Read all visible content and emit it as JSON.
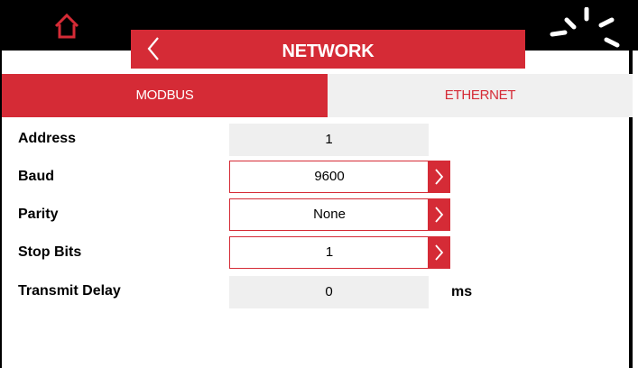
{
  "header": {
    "title": "NETWORK",
    "home_icon": "home-icon",
    "back_icon": "chevron-left-icon",
    "activity_icon": "loading-spinner-icon",
    "accent_color": "#d52b36"
  },
  "tabs": [
    {
      "label": "MODBUS",
      "active": true
    },
    {
      "label": "ETHERNET",
      "active": false
    }
  ],
  "settings": {
    "address": {
      "label": "Address",
      "value": "1"
    },
    "baud": {
      "label": "Baud",
      "value": "9600"
    },
    "parity": {
      "label": "Parity",
      "value": "None"
    },
    "stop_bits": {
      "label": "Stop Bits",
      "value": "1"
    },
    "transmit_delay": {
      "label": "Transmit Delay",
      "value": "0",
      "unit": "ms"
    }
  }
}
